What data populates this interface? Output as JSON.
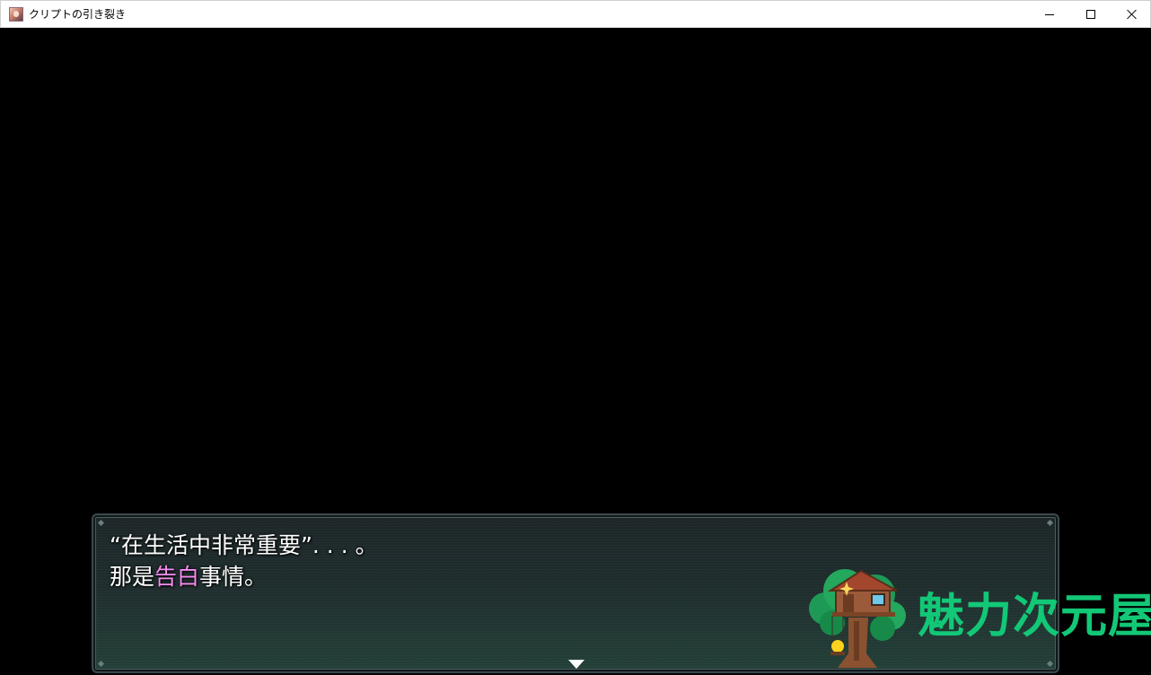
{
  "window": {
    "title": "クリプトの引き裂き",
    "controls": {
      "minimize_icon": "minimize-icon",
      "maximize_icon": "maximize-icon",
      "close_icon": "close-icon"
    }
  },
  "message": {
    "line1": "“在生活中非常重要”. . . 。",
    "line2_before": "那是",
    "line2_highlight": "告白",
    "line2_after": "事情。",
    "highlight_color": "#f58cf0",
    "advance_icon": "triangle-down-icon"
  },
  "watermark": {
    "text": "魅力次元屋",
    "color": "#12c877",
    "icon": "treehouse-logo-icon"
  }
}
